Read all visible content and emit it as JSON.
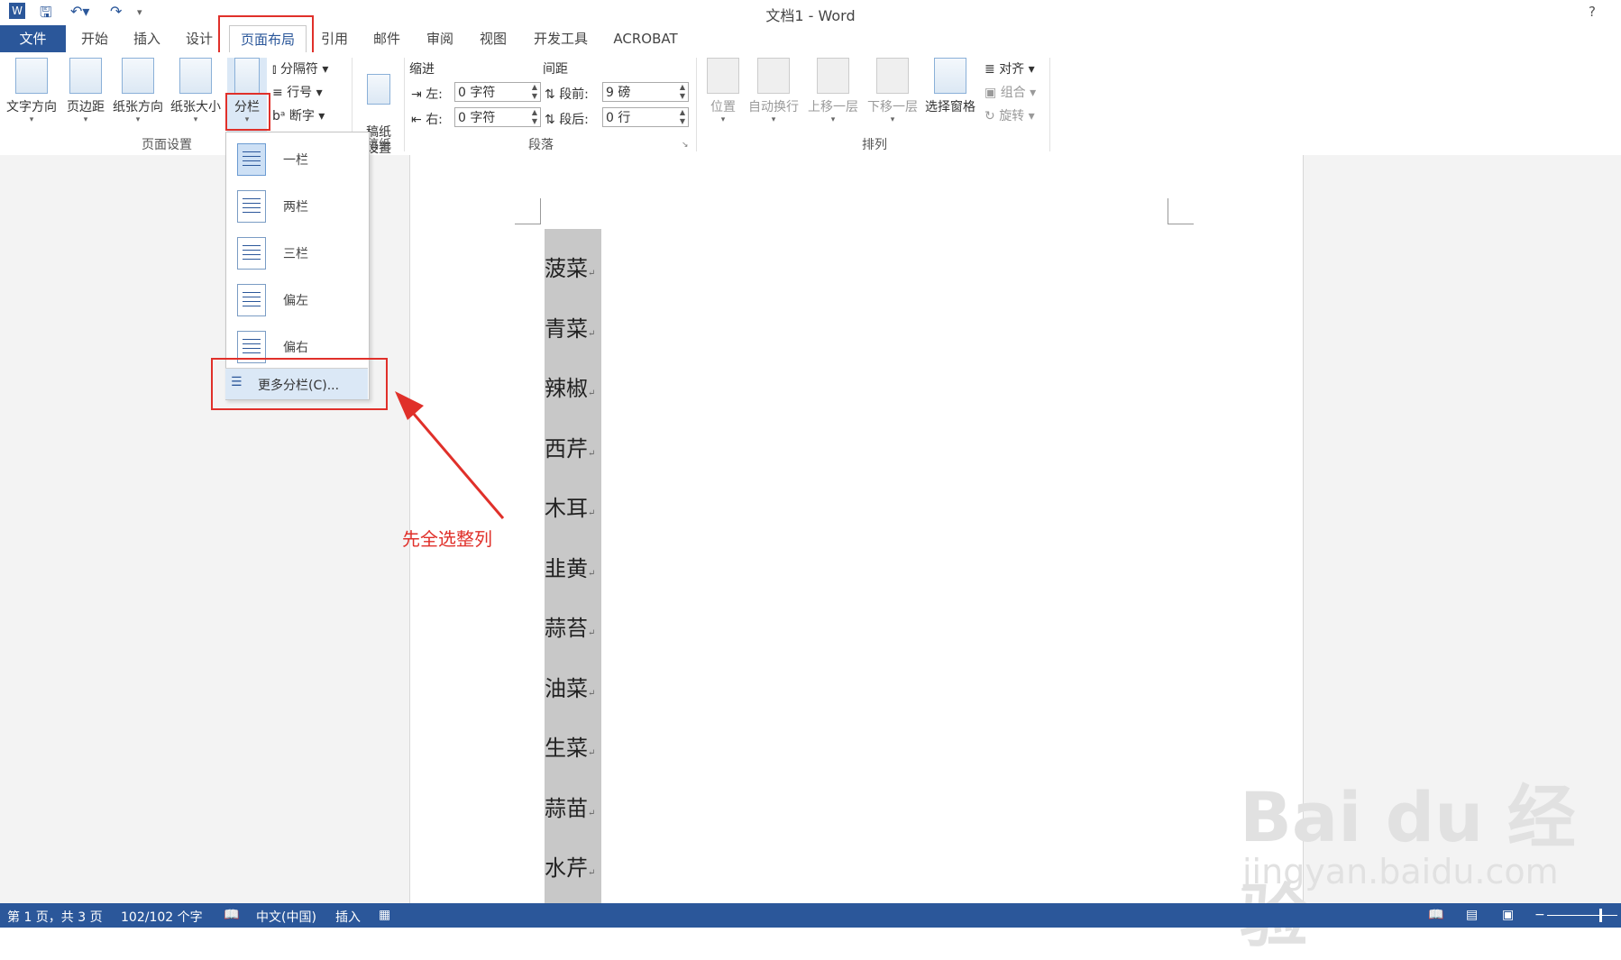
{
  "window": {
    "title": "文档1 - Word",
    "help": "?"
  },
  "tabs": [
    {
      "label": "文件"
    },
    {
      "label": "开始"
    },
    {
      "label": "插入"
    },
    {
      "label": "设计"
    },
    {
      "label": "页面布局"
    },
    {
      "label": "引用"
    },
    {
      "label": "邮件"
    },
    {
      "label": "审阅"
    },
    {
      "label": "视图"
    },
    {
      "label": "开发工具"
    },
    {
      "label": "ACROBAT"
    }
  ],
  "ribbon": {
    "page_setup": {
      "text_direction": "文字方向",
      "margins": "页边距",
      "orientation": "纸张方向",
      "size": "纸张大小",
      "columns": "分栏",
      "breaks": "分隔符",
      "line_numbers": "行号",
      "hyphenation": "断字",
      "group_label": "页面设置"
    },
    "draft": {
      "label": "稿纸\n设置",
      "group_label": "稿纸"
    },
    "paragraph": {
      "indent_label": "缩进",
      "spacing_label": "间距",
      "left_label": "左:",
      "left_value": "0 字符",
      "right_label": "右:",
      "right_value": "0 字符",
      "before_label": "段前:",
      "before_value": "9 磅",
      "after_label": "段后:",
      "after_value": "0 行",
      "group_label": "段落"
    },
    "arrange": {
      "position": "位置",
      "wrap_text": "自动换行",
      "bring_forward": "上移一层",
      "send_backward": "下移一层",
      "selection_pane": "选择窗格",
      "align": "对齐",
      "group": "组合",
      "rotate": "旋转",
      "group_label": "排列"
    }
  },
  "columns_menu": {
    "items": [
      {
        "label": "一栏"
      },
      {
        "label": "两栏"
      },
      {
        "label": "三栏"
      },
      {
        "label": "偏左"
      },
      {
        "label": "偏右"
      }
    ],
    "more": "更多分栏(C)..."
  },
  "document": {
    "lines": [
      "菠菜",
      "青菜",
      "辣椒",
      "西芹",
      "木耳",
      "韭黄",
      "蒜苔",
      "油菜",
      "生菜",
      "蒜苗",
      "水芹"
    ],
    "paragraph_mark": "↵"
  },
  "annotation": "先全选整列",
  "status": {
    "page": "第 1 页，共 3 页",
    "words": "102/102 个字",
    "language": "中文(中国)",
    "mode": "插入"
  },
  "watermark": {
    "main": "Bai du 经验",
    "sub": "jingyan.baidu.com"
  },
  "colors": {
    "accent": "#2b579a",
    "annotation": "#e0302a"
  }
}
